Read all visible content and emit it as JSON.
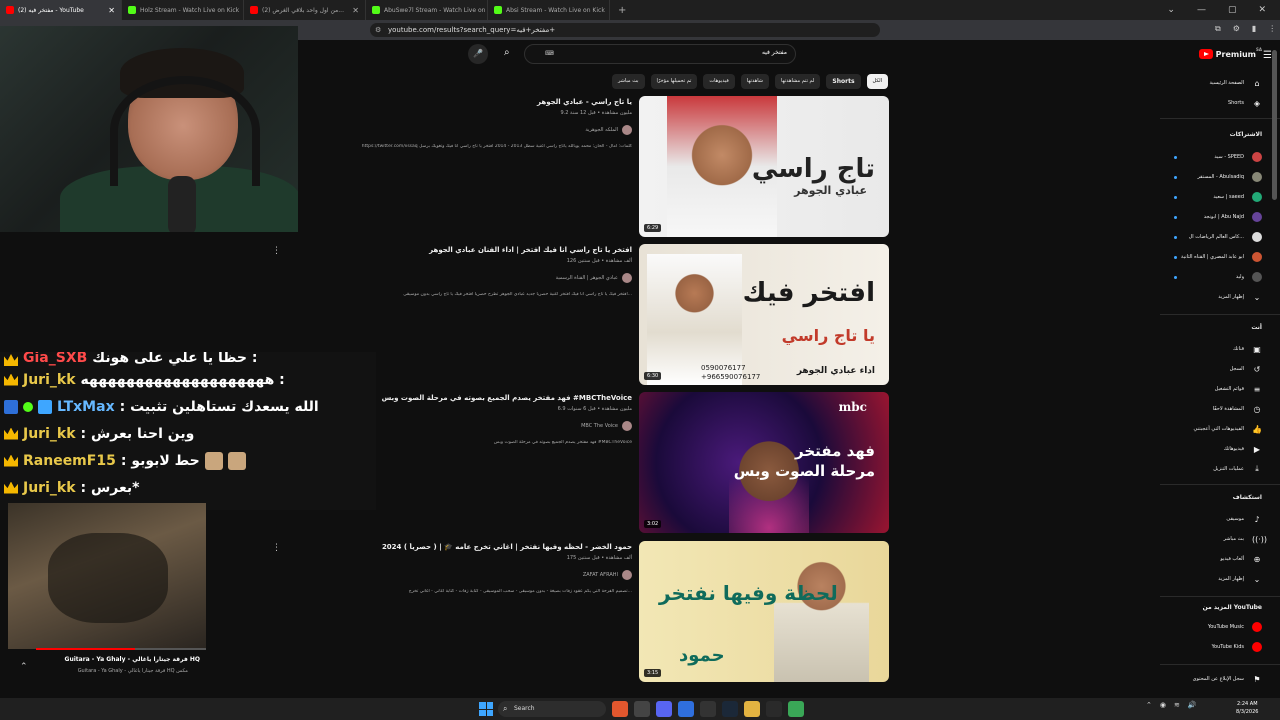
{
  "browser": {
    "tabs": [
      {
        "title": "(2) مفتخر فيه - YouTube",
        "color": "#ff0000",
        "active": true
      },
      {
        "title": "Holz Stream - Watch Live on Kick",
        "color": "#53fc18",
        "active": false
      },
      {
        "title": "(2) من اول واحد بلاقي الغرض...",
        "color": "#ff0000",
        "active": false
      },
      {
        "title": "AbuSwe7l Stream - Watch Live on Kick",
        "color": "#53fc18",
        "active": false
      },
      {
        "title": "Absi Stream - Watch Live on Kick",
        "color": "#53fc18",
        "active": false
      }
    ],
    "new_tab": "+",
    "url": "youtube.com/results?search_query=مفتخر+فيه+"
  },
  "search": {
    "query": "مفتخر فيه",
    "keyboard_hint": "⌨"
  },
  "chips": [
    {
      "label": "الكل",
      "active": true,
      "bold": false
    },
    {
      "label": "Shorts",
      "active": false,
      "bold": true
    },
    {
      "label": "لم تتم مشاهدتها",
      "active": false,
      "bold": false
    },
    {
      "label": "شاهدتها",
      "active": false,
      "bold": false
    },
    {
      "label": "فيديوهات",
      "active": false,
      "bold": false
    },
    {
      "label": "تم تحميلها مؤخرًا",
      "active": false,
      "bold": false
    },
    {
      "label": "بث مباشر",
      "active": false,
      "bold": false
    }
  ],
  "results": [
    {
      "title": "يا تاج راسي - عبادي الجوهر",
      "stats": "9.2 مليون مشاهدة • قبل 12 سنة",
      "channel": "الملكه الجوهرية",
      "desc": "https://twitter.com/iissaq كلمات: آمال - ألحان: محمد يوبالله ياتاج راسي أغنية سطل 2013 - 2014 أفتخر يا تاج راسي أنا فيك وتغويك برسل",
      "duration": "6:29",
      "thumb_text": "تاج راسي",
      "thumb_sub": "عبادي الجوهر"
    },
    {
      "title": "افتخر يا تاج راسي انا فيك افتخر | اداء الفنان عبادي الجوهر",
      "stats": "126 ألف مشاهدة • قبل سنتين",
      "channel": "عبادي الجوهر | القناة الرسمية",
      "desc": "افتخر فيك يا تاج راسي انا فيك افتخر اغنية حصرياً جديد عبادي الجوهر تطرح حصرياً افتخر فيك يا تاج راسي بدون موسيقى...",
      "duration": "6:30",
      "thumb_text": "افتخر فيك",
      "thumb_sub": "يا تاج راسي",
      "thumb_caption": "اداء عبادي الجوهر",
      "thumb_phone": "0590076177\n+966590076177"
    },
    {
      "title": "فهد مفتخر يصدم الجميع بصوته في مرحلة الصوت وبس #MBCTheVoice",
      "stats": "6.9 مليون مشاهدة • قبل 6 سنوات",
      "channel": "MBC The Voice",
      "desc": "فهد مفتخر يصدم الجميع بصوته في مرحلة الصوت وبس #MBCTheVoice",
      "duration": "3:02",
      "thumb_text": "فهد مفتخر",
      "thumb_sub": "مرحلة الصوت وبس",
      "thumb_brand": "mbc"
    },
    {
      "title": "حمود الخضر - لحظه وفيها نفتخر | اغاني تخرج عامه 🎓 | ( حصرياً ) 2024",
      "stats": "175 ألف مشاهدة • قبل سنتين",
      "channel": "ZAFAT AFRAHI",
      "desc": "تصميم الفرحة التي يكم عقود زفات بصيغة - بدون موسيقى - سحب الموسيقى - كتابة زفات - كتابة اغاني - اغاني تخرج...",
      "duration": "3:15",
      "thumb_text": "لحظة وفيها نفتخر",
      "thumb_sub": "حمود"
    }
  ],
  "sidebar": {
    "brand": "Premium",
    "region": "SA",
    "nav": [
      {
        "label": "الصفحة الرئيسية",
        "icon": "home-icon",
        "glyph": "⌂"
      },
      {
        "label": "Shorts",
        "icon": "shorts-icon",
        "glyph": "◈"
      }
    ],
    "subs_title": "الاشتراكات",
    "subs": [
      {
        "label": "سيد - SPEED",
        "color": "#c44"
      },
      {
        "label": "المستقر - Abulsadiq",
        "color": "#887"
      },
      {
        "label": "سعيد | saeed",
        "color": "#2a7"
      },
      {
        "label": "ابونجد | Abu Najd",
        "color": "#649"
      },
      {
        "label": "كاس العالم الرياضات ال...",
        "color": "#ddd"
      },
      {
        "label": "ابو عابد المصري | القناه الثانية",
        "color": "#c53"
      },
      {
        "label": "وليد",
        "color": "#555"
      }
    ],
    "show_more": "إظهار المزيد",
    "you_title": "أنت",
    "you_items": [
      {
        "label": "قناتك",
        "glyph": "▣"
      },
      {
        "label": "السجل",
        "glyph": "↺"
      },
      {
        "label": "قوائم التشغيل",
        "glyph": "≡"
      },
      {
        "label": "المشاهدة لاحقًا",
        "glyph": "◷"
      },
      {
        "label": "الفيديوهات التي أعجبتني",
        "glyph": "👍"
      },
      {
        "label": "فيديوهاتك",
        "glyph": "▶"
      },
      {
        "label": "عمليات التنزيل",
        "glyph": "⤓"
      }
    ],
    "explore_title": "استكشاف",
    "explore_items": [
      {
        "label": "موسيقى",
        "glyph": "♪"
      },
      {
        "label": "بث مباشر",
        "glyph": "((·))"
      },
      {
        "label": "ألعاب فيديو",
        "glyph": "⊕"
      },
      {
        "label": "إظهار المزيد",
        "glyph": "⌄"
      }
    ],
    "more_title": "المزيد من YouTube",
    "more_items": [
      {
        "label": "YouTube Music",
        "color": "#ff0000"
      },
      {
        "label": "YouTube Kids",
        "color": "#ff0000"
      }
    ],
    "report": "سجل الإبلاغ عن المحتوى"
  },
  "chat": [
    {
      "badges": [
        "crown"
      ],
      "name": "Gia_SXB",
      "msg": "حظا يا علي على هونك :",
      "color": "red",
      "cut": true
    },
    {
      "badges": [
        "crown"
      ],
      "name": "Juri_kk",
      "msg": "ههههههههههههههههههههه :",
      "color": "gold",
      "cut": false
    },
    {
      "badges": [
        "mod",
        "check",
        "blue"
      ],
      "name": "LTxMax",
      "msg": ": الله يسعدك تستاهلين تثبيت",
      "color": "blue",
      "cut": false
    },
    {
      "badges": [
        "crown"
      ],
      "name": "Juri_kk",
      "msg": ": وين احنا بعرش",
      "color": "gold",
      "cut": false
    },
    {
      "badges": [
        "crown"
      ],
      "name": "RaneemF15",
      "msg": ": حط لابوبو",
      "color": "gold",
      "cut": false
    },
    {
      "badges": [
        "crown"
      ],
      "name": "Juri_kk",
      "msg": ": بعرس*",
      "color": "gold",
      "cut": false
    }
  ],
  "mini_player": {
    "title": "Guitara - Ya Ghaly - فرقة جيتارا ياغالي HQ",
    "subtitle": "Guitara - Ya Ghaly - فرقة جيتارا ياغالي HQ مكس",
    "progress": 0.58
  },
  "taskbar": {
    "search_label": "Search",
    "time": "2:24 AM",
    "date": "8/3/2026"
  }
}
